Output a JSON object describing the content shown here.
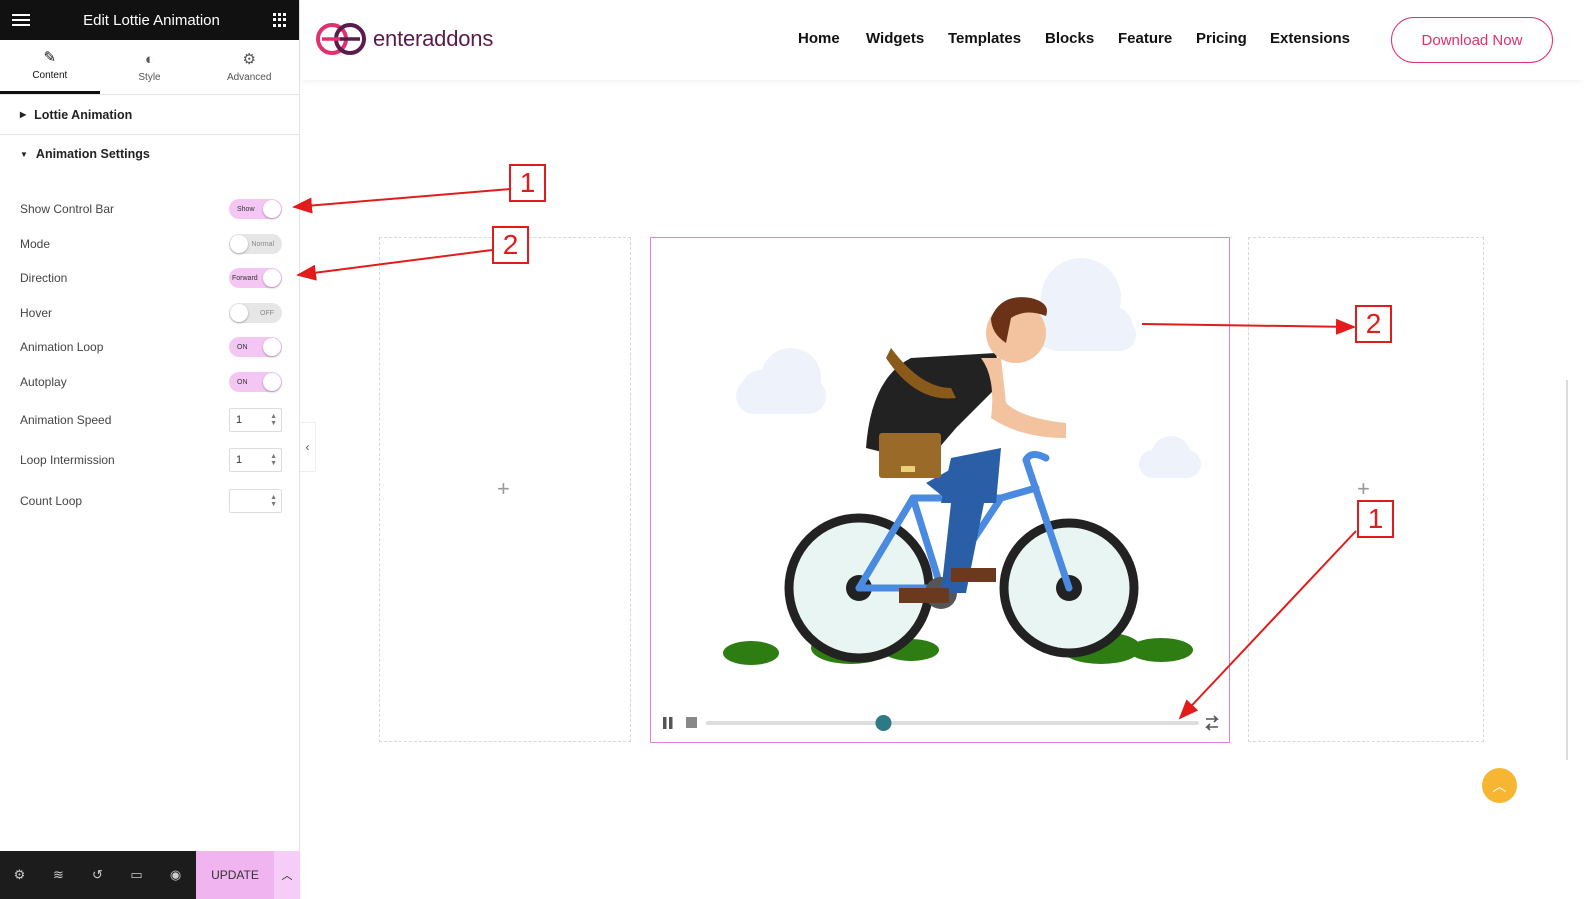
{
  "sidebar": {
    "title": "Edit Lottie Animation",
    "tabs": [
      {
        "label": "Content",
        "icon": "pencil-icon"
      },
      {
        "label": "Style",
        "icon": "half-circle-icon"
      },
      {
        "label": "Advanced",
        "icon": "gear-icon"
      }
    ],
    "sections": {
      "lottie": "Lottie Animation",
      "settings": "Animation Settings"
    },
    "controls": {
      "show_control_bar": {
        "label": "Show Control Bar",
        "state": "Show"
      },
      "mode": {
        "label": "Mode",
        "state": "Normal"
      },
      "direction": {
        "label": "Direction",
        "state": "Forward"
      },
      "hover": {
        "label": "Hover",
        "state": "OFF"
      },
      "loop": {
        "label": "Animation Loop",
        "state": "ON"
      },
      "autoplay": {
        "label": "Autoplay",
        "state": "ON"
      },
      "speed": {
        "label": "Animation Speed",
        "value": "1"
      },
      "intermission": {
        "label": "Loop Intermission",
        "value": "1"
      },
      "count": {
        "label": "Count Loop",
        "value": ""
      }
    },
    "footer": {
      "update": "UPDATE"
    }
  },
  "site": {
    "logo": "enteraddons",
    "menu": [
      "Home",
      "Widgets",
      "Templates",
      "Blocks",
      "Feature",
      "Pricing",
      "Extensions"
    ],
    "cta": "Download Now"
  },
  "player": {
    "progress": 0.36
  },
  "annotations": [
    "1",
    "2",
    "2",
    "1"
  ],
  "colors": {
    "accent": "#e0306e",
    "toggle_on": "#f4c6f4",
    "frame": "#e27de2",
    "annotation": "#e21b1b"
  }
}
